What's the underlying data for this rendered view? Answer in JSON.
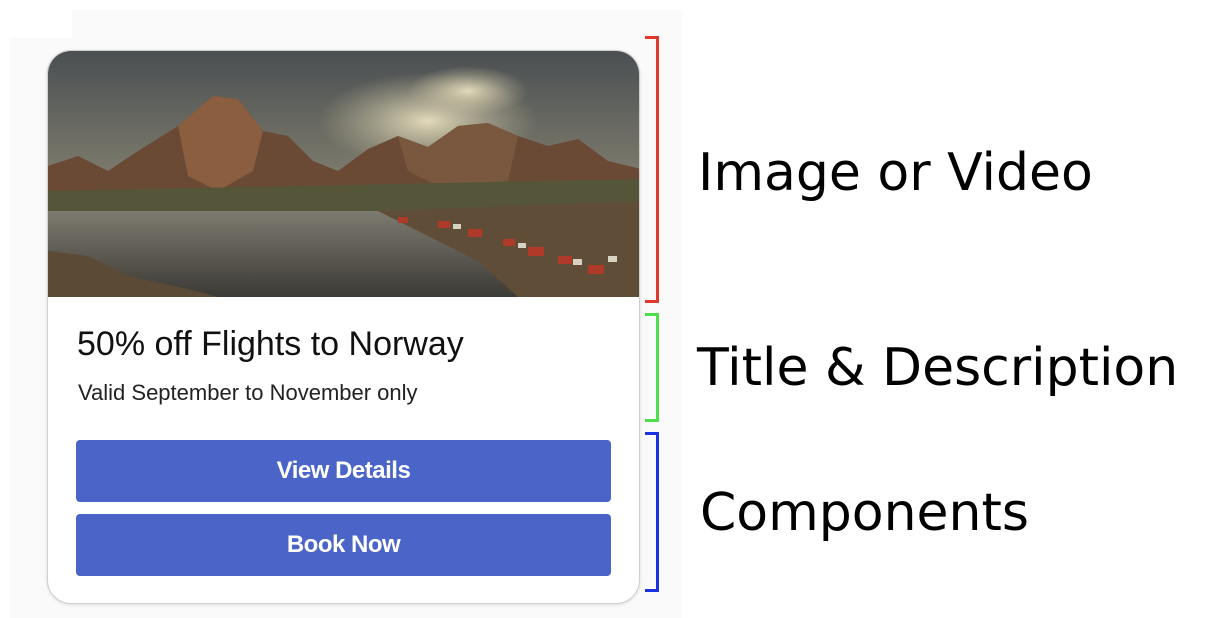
{
  "card": {
    "title": "50% off Flights to Norway",
    "description": "Valid September to November only",
    "buttons": [
      {
        "label": "View Details"
      },
      {
        "label": "Book Now"
      }
    ],
    "image_alt": "Mountains and fjord village landscape",
    "button_color": "#4a65c7"
  },
  "annotations": [
    {
      "label": "Image or Video",
      "color": "#e03a2f"
    },
    {
      "label": "Title & Description",
      "color": "#4ee04a"
    },
    {
      "label": "Components",
      "color": "#1a33e0"
    }
  ]
}
